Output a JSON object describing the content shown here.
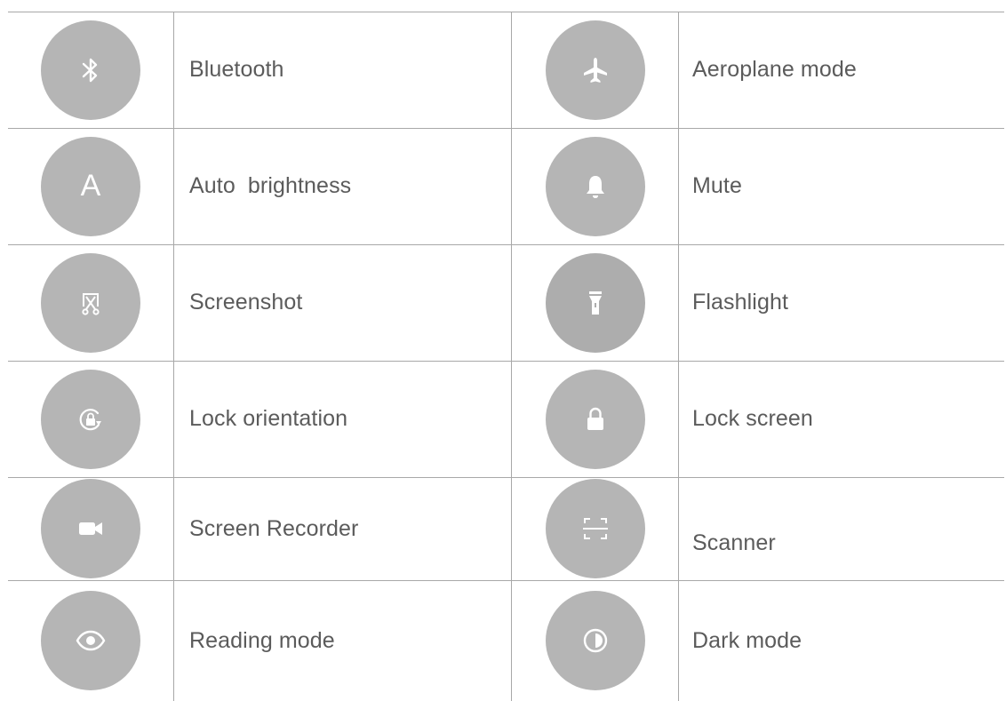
{
  "quick_settings_table": {
    "rows": [
      {
        "left": {
          "icon": "bluetooth-icon",
          "label": "Bluetooth"
        },
        "right": {
          "icon": "airplane-icon",
          "label": "Aeroplane mode"
        }
      },
      {
        "left": {
          "icon": "auto-brightness-icon",
          "icon_text": "A",
          "label": "Auto  brightness"
        },
        "right": {
          "icon": "bell-icon",
          "label": "Mute"
        }
      },
      {
        "left": {
          "icon": "screenshot-icon",
          "label": "Screenshot"
        },
        "right": {
          "icon": "flashlight-icon",
          "label": "Flashlight"
        }
      },
      {
        "left": {
          "icon": "rotation-lock-icon",
          "label": "Lock orientation"
        },
        "right": {
          "icon": "padlock-icon",
          "label": "Lock screen"
        }
      },
      {
        "left": {
          "icon": "video-camera-icon",
          "label": "Screen Recorder"
        },
        "right": {
          "icon": "scanner-icon",
          "label": "Scanner"
        }
      },
      {
        "left": {
          "icon": "eye-icon",
          "label": "Reading mode"
        },
        "right": {
          "icon": "contrast-icon",
          "label": "Dark mode"
        }
      }
    ]
  },
  "colors": {
    "icon_circle": "#b5b5b5",
    "icon_glyph": "#ffffff",
    "label_text": "#5b5b5b",
    "rule_lines": "#a8a8a8"
  }
}
